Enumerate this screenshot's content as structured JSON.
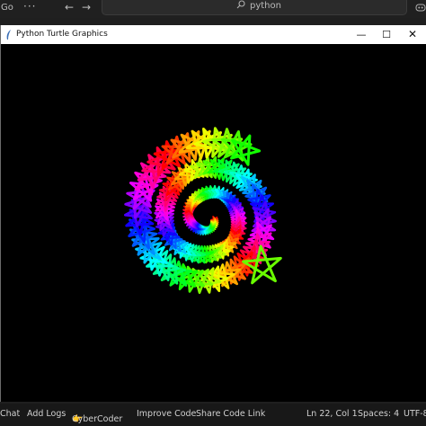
{
  "editor_topbar": {
    "menu_label": "Go",
    "more_icon": "ellipsis-icon",
    "back_icon": "arrow-left-icon",
    "forward_icon": "arrow-right-icon",
    "search_text": "python",
    "search_icon": "search-icon",
    "copilot_icon": "copilot-icon"
  },
  "turtle_window": {
    "title": "Python Turtle Graphics",
    "app_icon": "feather-icon",
    "minimize_icon": "minimize-icon",
    "maximize_icon": "maximize-icon",
    "close_icon": "close-icon",
    "canvas_background": "#000000",
    "drawing": {
      "description_shape": "rainbow spiral of five-pointed stars",
      "colors": [
        "#ff0000",
        "#ff8000",
        "#ffff00",
        "#00ff00",
        "#00ffff",
        "#0080ff",
        "#8000ff",
        "#ff00ff"
      ]
    }
  },
  "statusbar": {
    "chat": "Chat",
    "add_logs": "Add Logs",
    "cybercoder": "CyberCoder",
    "improve_code": "Improve Code",
    "share_code_link": "Share Code Link",
    "cursor_position": "Ln 22, Col 1",
    "spaces": "Spaces: 4",
    "encoding": "UTF-8"
  }
}
